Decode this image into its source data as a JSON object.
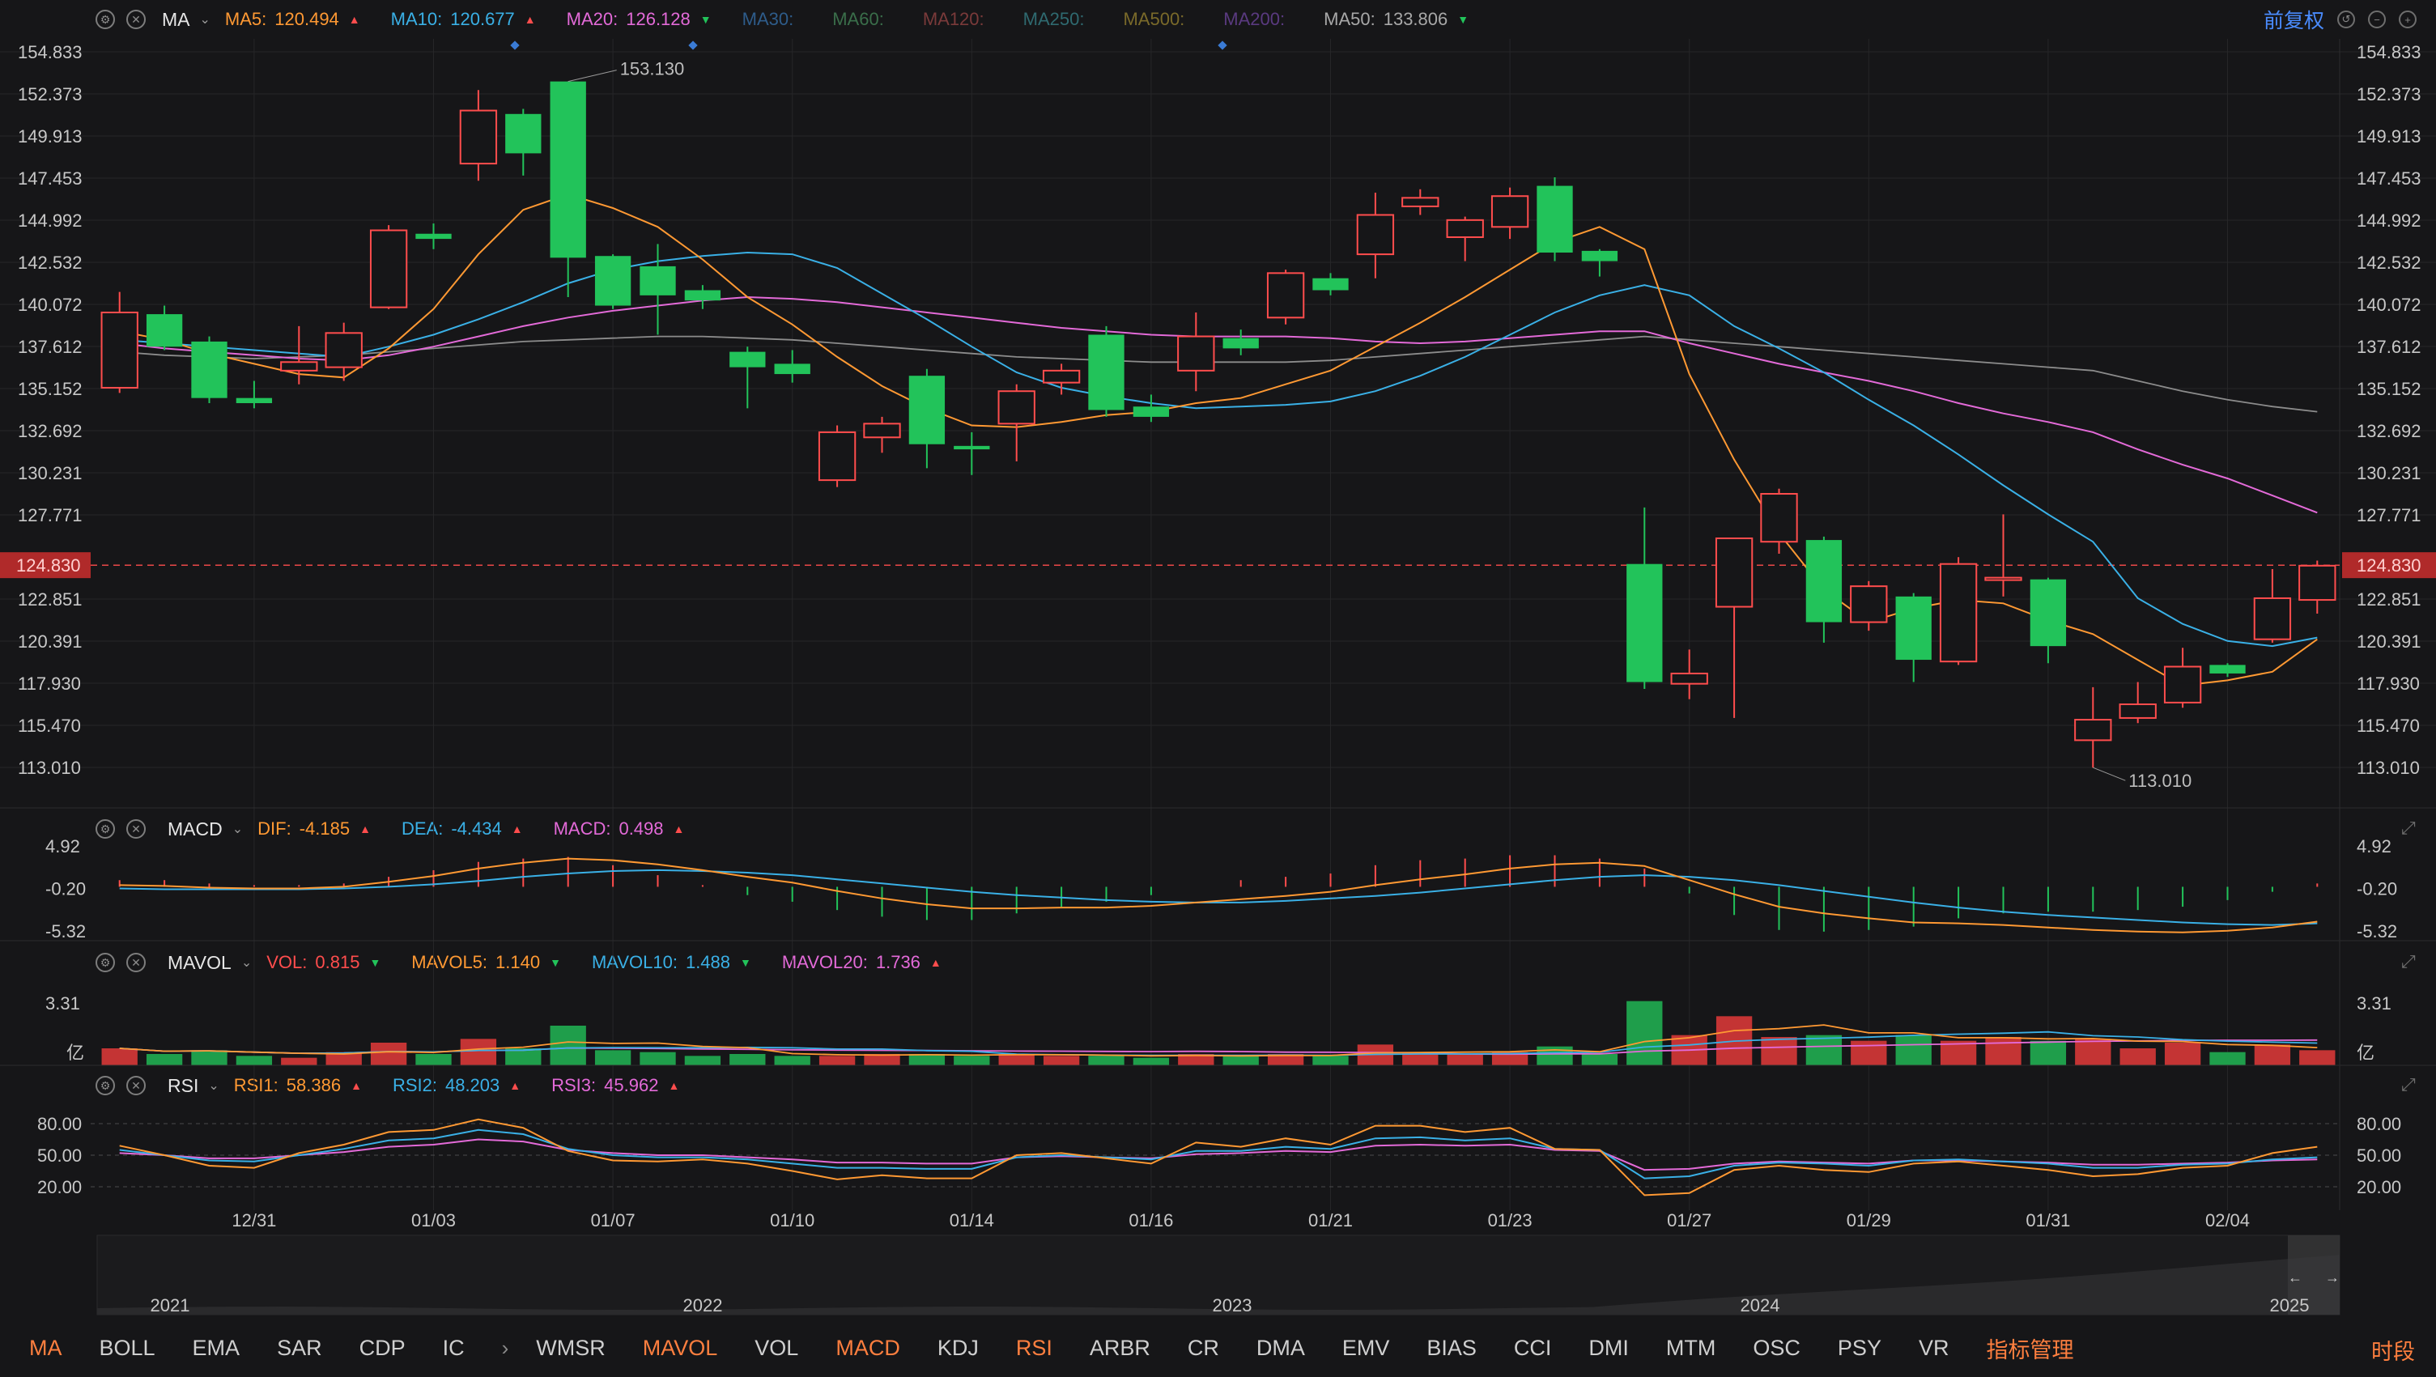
{
  "main_header": {
    "indicator_name": "MA",
    "items": [
      {
        "label": "MA5:",
        "value": "120.494",
        "dir": "up",
        "color": "#ff9933"
      },
      {
        "label": "MA10:",
        "value": "120.677",
        "dir": "up",
        "color": "#3ab0e6"
      },
      {
        "label": "MA20:",
        "value": "126.128",
        "dir": "down",
        "color": "#e36ad8"
      },
      {
        "label": "MA30:",
        "value": "",
        "dir": "",
        "color": "#2e5c8a"
      },
      {
        "label": "MA60:",
        "value": "",
        "dir": "",
        "color": "#3a6e4a"
      },
      {
        "label": "MA120:",
        "value": "",
        "dir": "",
        "color": "#7a3a3a"
      },
      {
        "label": "MA250:",
        "value": "",
        "dir": "",
        "color": "#2f6a70"
      },
      {
        "label": "MA500:",
        "value": "",
        "dir": "",
        "color": "#7a6a2a"
      },
      {
        "label": "MA200:",
        "value": "",
        "dir": "",
        "color": "#5a3a80"
      },
      {
        "label": "MA50:",
        "value": "133.806",
        "dir": "down",
        "color": "#a8a8a8"
      }
    ]
  },
  "top_right": {
    "adjust_label": "前复权"
  },
  "colors": {
    "up": "#ff4d4d",
    "down": "#22c35a",
    "background": "#161618",
    "grid": "#262628",
    "axis_text": "#c8c8c8",
    "ma5": "#ff9933",
    "ma10": "#3ab0e6",
    "ma20": "#e36ad8",
    "ma50": "#8c8c8c",
    "price_line": "#ff4d4d",
    "price_tag_bg": "#b02a2a"
  },
  "price_axis": {
    "ticks": [
      "154.833",
      "152.373",
      "149.913",
      "147.453",
      "144.992",
      "142.532",
      "140.072",
      "137.612",
      "135.152",
      "132.692",
      "130.231",
      "127.771",
      "122.851",
      "120.391",
      "117.930",
      "115.470",
      "113.010"
    ],
    "last_price": "124.830",
    "high_label": "153.130",
    "low_label": "113.010"
  },
  "date_labels": [
    "12/31",
    "01/03",
    "01/07",
    "01/10",
    "01/14",
    "01/16",
    "01/21",
    "01/23",
    "01/27",
    "01/29",
    "01/31",
    "02/04"
  ],
  "chart_data": {
    "type": "candlestick",
    "ylim": [
      113.01,
      154.833
    ],
    "candles": [
      {
        "o": 135.2,
        "h": 140.8,
        "l": 134.9,
        "c": 139.6
      },
      {
        "o": 139.5,
        "h": 140.0,
        "l": 137.4,
        "c": 137.6
      },
      {
        "o": 137.9,
        "h": 138.2,
        "l": 134.3,
        "c": 134.6
      },
      {
        "o": 134.6,
        "h": 135.6,
        "l": 134.0,
        "c": 134.3
      },
      {
        "o": 136.2,
        "h": 138.8,
        "l": 135.4,
        "c": 136.7
      },
      {
        "o": 136.4,
        "h": 139.0,
        "l": 135.6,
        "c": 138.4
      },
      {
        "o": 139.9,
        "h": 144.7,
        "l": 139.8,
        "c": 144.4
      },
      {
        "o": 144.2,
        "h": 144.8,
        "l": 143.3,
        "c": 143.9
      },
      {
        "o": 148.3,
        "h": 152.6,
        "l": 147.3,
        "c": 151.4
      },
      {
        "o": 151.2,
        "h": 151.5,
        "l": 147.6,
        "c": 148.9
      },
      {
        "o": 153.1,
        "h": 153.1,
        "l": 140.5,
        "c": 142.8
      },
      {
        "o": 142.9,
        "h": 143.0,
        "l": 139.8,
        "c": 140.0
      },
      {
        "o": 142.3,
        "h": 143.6,
        "l": 138.3,
        "c": 140.6
      },
      {
        "o": 140.9,
        "h": 141.2,
        "l": 139.8,
        "c": 140.3
      },
      {
        "o": 137.3,
        "h": 137.6,
        "l": 134.0,
        "c": 136.4
      },
      {
        "o": 136.6,
        "h": 137.4,
        "l": 135.5,
        "c": 136.0
      },
      {
        "o": 129.8,
        "h": 133.0,
        "l": 129.4,
        "c": 132.6
      },
      {
        "o": 132.3,
        "h": 133.5,
        "l": 131.4,
        "c": 133.1
      },
      {
        "o": 135.9,
        "h": 136.3,
        "l": 130.5,
        "c": 131.9
      },
      {
        "o": 131.8,
        "h": 132.6,
        "l": 130.1,
        "c": 131.6
      },
      {
        "o": 133.1,
        "h": 135.4,
        "l": 130.9,
        "c": 135.0
      },
      {
        "o": 135.5,
        "h": 136.6,
        "l": 134.8,
        "c": 136.2
      },
      {
        "o": 138.3,
        "h": 138.8,
        "l": 133.5,
        "c": 133.9
      },
      {
        "o": 134.1,
        "h": 134.8,
        "l": 133.2,
        "c": 133.5
      },
      {
        "o": 136.2,
        "h": 139.6,
        "l": 135.0,
        "c": 138.2
      },
      {
        "o": 138.1,
        "h": 138.6,
        "l": 137.1,
        "c": 137.5
      },
      {
        "o": 139.3,
        "h": 142.1,
        "l": 138.9,
        "c": 141.9
      },
      {
        "o": 141.6,
        "h": 141.9,
        "l": 140.6,
        "c": 140.9
      },
      {
        "o": 143.0,
        "h": 146.6,
        "l": 141.6,
        "c": 145.3
      },
      {
        "o": 145.8,
        "h": 146.8,
        "l": 145.3,
        "c": 146.3
      },
      {
        "o": 144.0,
        "h": 145.2,
        "l": 142.6,
        "c": 145.0
      },
      {
        "o": 144.6,
        "h": 146.9,
        "l": 143.9,
        "c": 146.4
      },
      {
        "o": 147.0,
        "h": 147.5,
        "l": 142.6,
        "c": 143.1
      },
      {
        "o": 143.2,
        "h": 143.3,
        "l": 141.7,
        "c": 142.6
      },
      {
        "o": 124.9,
        "h": 128.2,
        "l": 117.6,
        "c": 118.0
      },
      {
        "o": 117.9,
        "h": 119.9,
        "l": 117.0,
        "c": 118.5
      },
      {
        "o": 122.4,
        "h": 125.9,
        "l": 115.9,
        "c": 126.4
      },
      {
        "o": 126.2,
        "h": 129.3,
        "l": 125.5,
        "c": 129.0
      },
      {
        "o": 126.3,
        "h": 126.5,
        "l": 120.3,
        "c": 121.5
      },
      {
        "o": 121.5,
        "h": 123.9,
        "l": 121.0,
        "c": 123.6
      },
      {
        "o": 123.0,
        "h": 123.2,
        "l": 118.0,
        "c": 119.3
      },
      {
        "o": 119.2,
        "h": 125.3,
        "l": 119.0,
        "c": 124.9
      },
      {
        "o": 124.0,
        "h": 127.8,
        "l": 123.0,
        "c": 124.1
      },
      {
        "o": 124.0,
        "h": 124.1,
        "l": 119.1,
        "c": 120.1
      },
      {
        "o": 114.6,
        "h": 117.7,
        "l": 113.0,
        "c": 115.8
      },
      {
        "o": 115.9,
        "h": 118.0,
        "l": 115.6,
        "c": 116.7
      },
      {
        "o": 116.8,
        "h": 120.0,
        "l": 116.5,
        "c": 118.9
      },
      {
        "o": 119.0,
        "h": 119.1,
        "l": 118.3,
        "c": 118.5
      },
      {
        "o": 120.5,
        "h": 124.6,
        "l": 120.3,
        "c": 122.9
      },
      {
        "o": 122.8,
        "h": 125.1,
        "l": 122.0,
        "c": 124.8
      }
    ],
    "ma5": [
      138.5,
      138.0,
      137.2,
      136.6,
      136.0,
      135.8,
      137.5,
      139.8,
      143.0,
      145.6,
      146.5,
      145.7,
      144.6,
      142.7,
      140.5,
      138.9,
      137.0,
      135.3,
      134.0,
      133.0,
      132.9,
      133.2,
      133.6,
      133.8,
      134.3,
      134.6,
      135.4,
      136.2,
      137.6,
      139.0,
      140.5,
      142.1,
      143.7,
      144.6,
      143.3,
      136.0,
      131.0,
      126.7,
      123.4,
      121.5,
      122.3,
      122.8,
      122.6,
      121.6,
      120.8,
      119.3,
      117.8,
      118.1,
      118.6,
      120.5
    ],
    "ma10": [
      138.0,
      137.8,
      137.6,
      137.4,
      137.2,
      137.0,
      137.6,
      138.3,
      139.2,
      140.2,
      141.3,
      142.1,
      142.6,
      142.9,
      143.1,
      143.0,
      142.2,
      140.7,
      139.2,
      137.6,
      136.1,
      135.2,
      134.7,
      134.3,
      134.0,
      134.1,
      134.2,
      134.4,
      135.0,
      135.9,
      137.0,
      138.3,
      139.6,
      140.6,
      141.2,
      140.6,
      138.8,
      137.5,
      136.1,
      134.5,
      133.0,
      131.3,
      129.5,
      127.8,
      126.2,
      122.9,
      121.4,
      120.4,
      120.1,
      120.6
    ],
    "ma20": [
      137.8,
      137.5,
      137.3,
      137.1,
      136.9,
      136.8,
      137.1,
      137.6,
      138.2,
      138.8,
      139.3,
      139.7,
      140.0,
      140.3,
      140.5,
      140.4,
      140.2,
      139.9,
      139.6,
      139.3,
      139.0,
      138.7,
      138.5,
      138.3,
      138.2,
      138.2,
      138.2,
      138.1,
      137.9,
      137.8,
      137.9,
      138.1,
      138.3,
      138.5,
      138.5,
      137.8,
      137.2,
      136.6,
      136.1,
      135.6,
      135.0,
      134.3,
      133.7,
      133.2,
      132.6,
      131.6,
      130.7,
      129.9,
      128.9,
      127.9
    ],
    "ma50": [
      137.3,
      137.1,
      137.0,
      136.9,
      137.0,
      137.1,
      137.3,
      137.5,
      137.7,
      137.9,
      138.0,
      138.1,
      138.2,
      138.2,
      138.1,
      138.0,
      137.8,
      137.6,
      137.4,
      137.2,
      137.0,
      136.9,
      136.8,
      136.7,
      136.7,
      136.7,
      136.7,
      136.8,
      137.0,
      137.2,
      137.4,
      137.6,
      137.8,
      138.0,
      138.2,
      138.0,
      137.8,
      137.6,
      137.4,
      137.2,
      137.0,
      136.8,
      136.6,
      136.4,
      136.2,
      135.6,
      135.0,
      134.5,
      134.1,
      133.8
    ]
  },
  "macd": {
    "name": "MACD",
    "items": [
      {
        "label": "DIF:",
        "value": "-4.185",
        "dir": "up",
        "color": "#ff9933"
      },
      {
        "label": "DEA:",
        "value": "-4.434",
        "dir": "up",
        "color": "#3ab0e6"
      },
      {
        "label": "MACD:",
        "value": "0.498",
        "dir": "up",
        "color": "#e36ad8"
      }
    ],
    "ticks": [
      "4.92",
      "-0.20",
      "-5.32"
    ],
    "dif": [
      0.2,
      0.1,
      -0.1,
      -0.2,
      -0.2,
      0.0,
      0.6,
      1.3,
      2.2,
      2.9,
      3.4,
      3.2,
      2.7,
      2.0,
      1.2,
      0.5,
      -0.5,
      -1.4,
      -2.1,
      -2.6,
      -2.6,
      -2.5,
      -2.5,
      -2.3,
      -1.9,
      -1.5,
      -1.1,
      -0.6,
      0.2,
      0.9,
      1.5,
      2.2,
      2.7,
      2.9,
      2.5,
      0.8,
      -0.9,
      -2.4,
      -3.2,
      -3.8,
      -4.3,
      -4.4,
      -4.6,
      -4.9,
      -5.2,
      -5.4,
      -5.5,
      -5.3,
      -4.9,
      -4.2
    ],
    "dea": [
      -0.2,
      -0.3,
      -0.3,
      -0.3,
      -0.3,
      -0.2,
      0.0,
      0.3,
      0.7,
      1.2,
      1.6,
      1.9,
      2.0,
      1.9,
      1.7,
      1.4,
      0.9,
      0.4,
      -0.1,
      -0.6,
      -1.0,
      -1.3,
      -1.6,
      -1.8,
      -1.9,
      -1.9,
      -1.7,
      -1.4,
      -1.1,
      -0.7,
      -0.2,
      0.3,
      0.8,
      1.2,
      1.4,
      1.2,
      0.8,
      0.2,
      -0.5,
      -1.2,
      -1.9,
      -2.5,
      -3.0,
      -3.4,
      -3.7,
      -4.0,
      -4.3,
      -4.5,
      -4.6,
      -4.4
    ]
  },
  "mavol": {
    "name": "MAVOL",
    "items": [
      {
        "label": "VOL:",
        "value": "0.815",
        "dir": "down",
        "color": "#ff4d4d"
      },
      {
        "label": "MAVOL5:",
        "value": "1.140",
        "dir": "down",
        "color": "#ff9933"
      },
      {
        "label": "MAVOL10:",
        "value": "1.488",
        "dir": "down",
        "color": "#3ab0e6"
      },
      {
        "label": "MAVOL20:",
        "value": "1.736",
        "dir": "up",
        "color": "#e36ad8"
      }
    ],
    "ticks": [
      "3.31",
      "亿"
    ],
    "ylim": [
      0,
      3.6
    ],
    "volumes": [
      0.9,
      0.6,
      0.8,
      0.5,
      0.4,
      0.7,
      1.2,
      0.6,
      1.4,
      0.9,
      2.1,
      0.8,
      0.7,
      0.5,
      0.6,
      0.5,
      0.5,
      0.6,
      0.6,
      0.5,
      0.6,
      0.5,
      0.5,
      0.4,
      0.6,
      0.5,
      0.6,
      0.5,
      1.1,
      0.7,
      0.6,
      0.7,
      1.0,
      0.6,
      3.4,
      1.6,
      2.6,
      1.5,
      1.6,
      1.3,
      1.6,
      1.3,
      1.5,
      1.3,
      1.4,
      0.9,
      1.2,
      0.7,
      1.1,
      0.8
    ]
  },
  "rsi": {
    "name": "RSI",
    "items": [
      {
        "label": "RSI1:",
        "value": "58.386",
        "dir": "up",
        "color": "#ff9933"
      },
      {
        "label": "RSI2:",
        "value": "48.203",
        "dir": "up",
        "color": "#3ab0e6"
      },
      {
        "label": "RSI3:",
        "value": "45.962",
        "dir": "up",
        "color": "#e36ad8"
      }
    ],
    "ticks": [
      "80.00",
      "50.00",
      "20.00"
    ],
    "rsi1": [
      59,
      50,
      40,
      38,
      52,
      60,
      72,
      74,
      84,
      76,
      54,
      45,
      44,
      46,
      42,
      35,
      27,
      31,
      28,
      28,
      50,
      52,
      47,
      42,
      62,
      58,
      66,
      60,
      78,
      78,
      72,
      76,
      56,
      55,
      12,
      14,
      36,
      40,
      36,
      34,
      42,
      44,
      40,
      36,
      30,
      32,
      38,
      40,
      52,
      58
    ],
    "rsi2": [
      55,
      50,
      45,
      44,
      50,
      56,
      64,
      66,
      74,
      70,
      56,
      50,
      48,
      48,
      46,
      42,
      38,
      38,
      37,
      37,
      48,
      50,
      48,
      46,
      54,
      54,
      58,
      56,
      66,
      67,
      64,
      66,
      56,
      55,
      28,
      30,
      40,
      43,
      42,
      40,
      45,
      46,
      44,
      42,
      38,
      38,
      41,
      42,
      46,
      48
    ],
    "rsi3": [
      52,
      50,
      47,
      47,
      50,
      53,
      58,
      60,
      65,
      63,
      55,
      52,
      50,
      50,
      48,
      46,
      43,
      43,
      42,
      42,
      48,
      49,
      48,
      47,
      51,
      52,
      54,
      53,
      59,
      60,
      59,
      60,
      55,
      54,
      36,
      37,
      42,
      44,
      43,
      42,
      45,
      45,
      44,
      43,
      41,
      41,
      42,
      43,
      45,
      46
    ]
  },
  "overview": {
    "years": [
      "2021",
      "2022",
      "2023",
      "2024",
      "2025"
    ]
  },
  "bottom_tabs": [
    {
      "label": "MA",
      "active": true
    },
    {
      "label": "BOLL",
      "active": false
    },
    {
      "label": "EMA",
      "active": false
    },
    {
      "label": "SAR",
      "active": false
    },
    {
      "label": "CDP",
      "active": false
    },
    {
      "label": "IC",
      "active": false
    },
    {
      "label": "WMSR",
      "active": false
    },
    {
      "label": "MAVOL",
      "active": true
    },
    {
      "label": "VOL",
      "active": false
    },
    {
      "label": "MACD",
      "active": true
    },
    {
      "label": "KDJ",
      "active": false
    },
    {
      "label": "RSI",
      "active": true
    },
    {
      "label": "ARBR",
      "active": false
    },
    {
      "label": "CR",
      "active": false
    },
    {
      "label": "DMA",
      "active": false
    },
    {
      "label": "EMV",
      "active": false
    },
    {
      "label": "BIAS",
      "active": false
    },
    {
      "label": "CCI",
      "active": false
    },
    {
      "label": "DMI",
      "active": false
    },
    {
      "label": "MTM",
      "active": false
    },
    {
      "label": "OSC",
      "active": false
    },
    {
      "label": "PSY",
      "active": false
    },
    {
      "label": "VR",
      "active": false
    },
    {
      "label": "指标管理",
      "active": true
    }
  ],
  "timeshare_label": "时段"
}
